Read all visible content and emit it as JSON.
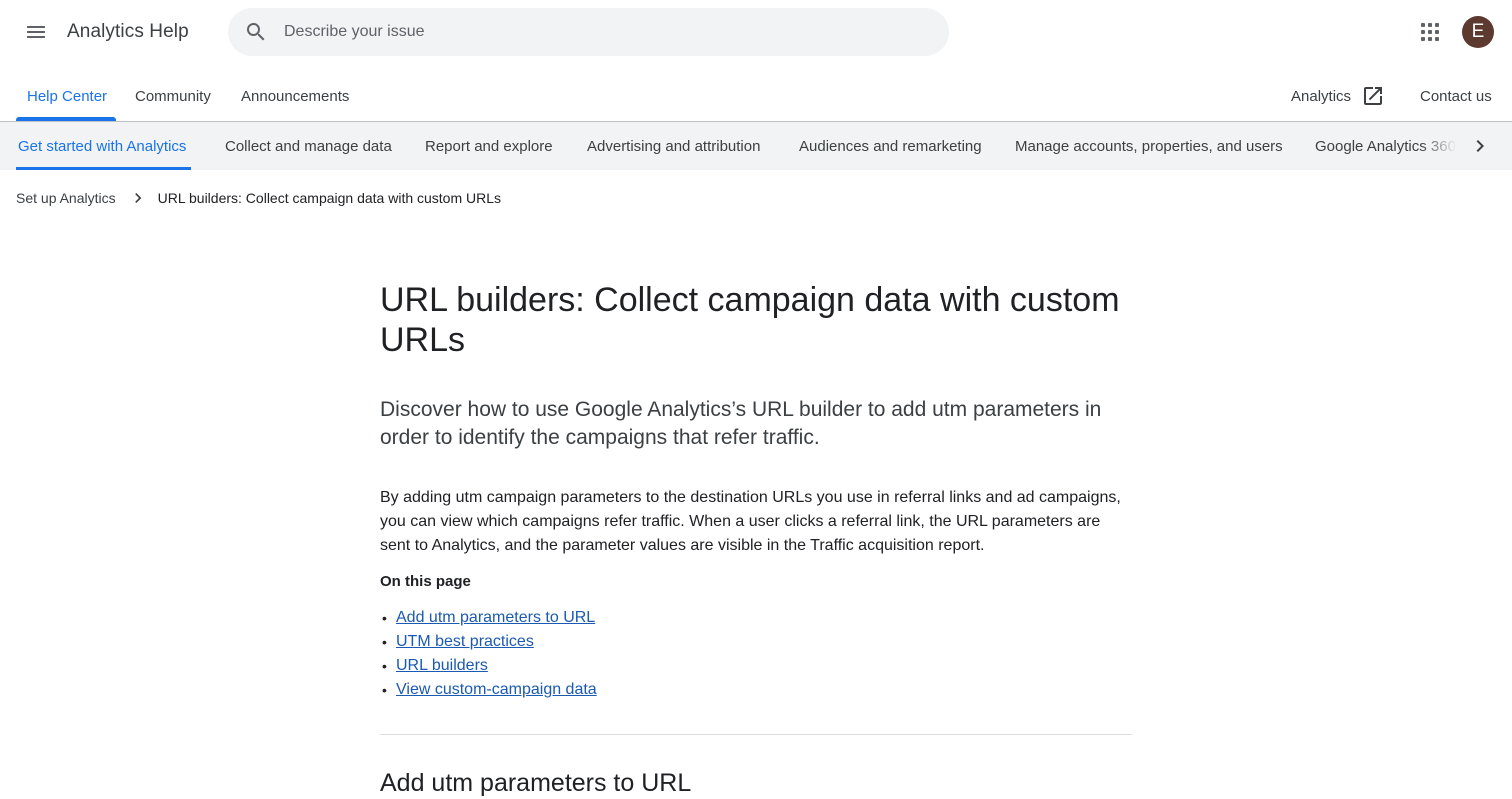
{
  "header": {
    "product_name": "Analytics Help",
    "search_placeholder": "Describe your issue",
    "search_value": "",
    "avatar_initial": "E",
    "avatar_color": "#5d3a2f"
  },
  "primary_tabs": {
    "help_center": "Help Center",
    "community": "Community",
    "announcements": "Announcements",
    "analytics": "Analytics",
    "contact_us": "Contact us"
  },
  "topics": [
    "Get started with Analytics",
    "Collect and manage data",
    "Report and explore",
    "Advertising and attribution",
    "Audiences and remarketing",
    "Manage accounts, properties, and users",
    "Google Analytics 360"
  ],
  "breadcrumb": {
    "parent": "Set up Analytics",
    "current": "URL builders: Collect campaign data with custom URLs"
  },
  "article": {
    "title": "URL builders: Collect campaign data with custom URLs",
    "lead": "Discover how to use Google Analytics’s URL builder to add utm parameters in order to identify the campaigns that refer traffic.",
    "body": "By adding utm campaign parameters to the destination URLs you use in referral links and ad campaigns, you can view which campaigns refer traffic. When a user clicks a referral link, the URL parameters are sent to Analytics, and the parameter values are visible in the Traffic acquisition report.",
    "toc_heading": "On this page",
    "toc": [
      "Add utm parameters to URL",
      "UTM best practices",
      "URL builders",
      "View custom-campaign data"
    ],
    "section_title": "Add utm parameters to URL"
  },
  "colors": {
    "accent": "#1a73e8",
    "link": "#1a5ab0",
    "topic_bar_bg": "#f1f3f4"
  }
}
